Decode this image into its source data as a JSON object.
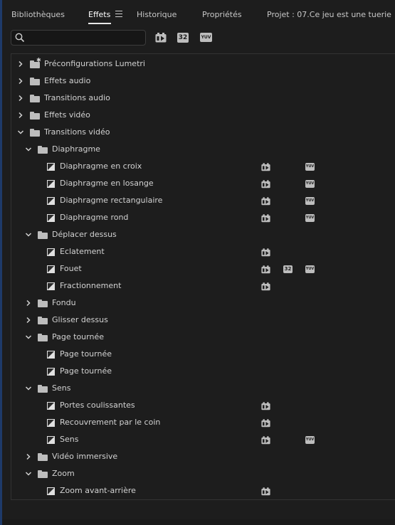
{
  "tabs": {
    "libraries": "Bibliothèques",
    "effects": "Effets",
    "history": "Historique",
    "properties": "Propriétés",
    "project": "Projet : 07.Ce jeu est une tuerie"
  },
  "search": {
    "placeholder": "",
    "value": ""
  },
  "toolbar": {
    "accelerated_label": "",
    "bit32_label": "32",
    "yuv_label": "YUV"
  },
  "tree": {
    "lumetri": "Préconfigurations Lumetri",
    "audio_effects": "Effets audio",
    "audio_transitions": "Transitions audio",
    "video_effects": "Effets vidéo",
    "video_transitions": "Transitions vidéo",
    "diaphragme": "Diaphragme",
    "diaphragme_croix": "Diaphragme en croix",
    "diaphragme_losange": "Diaphragme en losange",
    "diaphragme_rect": "Diaphragme rectangulaire",
    "diaphragme_rond": "Diaphragme rond",
    "deplacer": "Déplacer dessus",
    "eclatement": "Eclatement",
    "fouet": "Fouet",
    "fractionnement": "Fractionnement",
    "fondu": "Fondu",
    "glisser": "Glisser dessus",
    "page_tournee_folder": "Page tournée",
    "page_tournee_1": "Page tournée",
    "page_tournee_2": "Page tournée",
    "sens_folder": "Sens",
    "portes": "Portes coulissantes",
    "recouvrement": "Recouvrement par le coin",
    "sens": "Sens",
    "video_immersive": "Vidéo immersive",
    "zoom_folder": "Zoom",
    "zoom_avant": "Zoom avant-arrière"
  }
}
